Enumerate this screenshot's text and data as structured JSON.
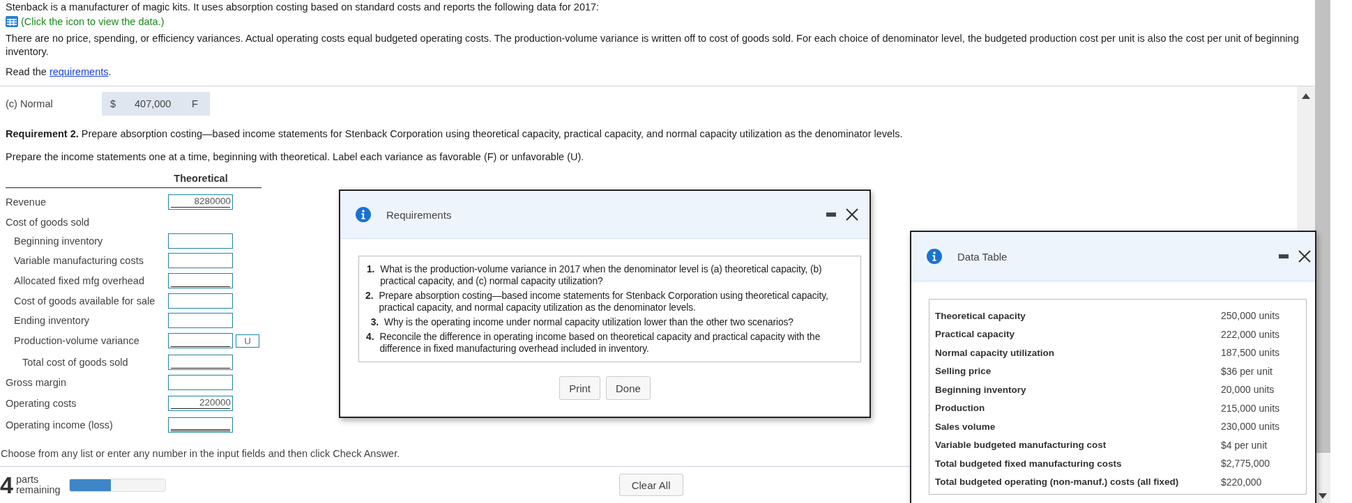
{
  "intro": {
    "text": "Stenback is a manufacturer of magic kits. It uses absorption costing based on standard costs and reports the following data for 2017:",
    "data_link": "(Click the icon to view the data.)",
    "note": "There are no price, spending, or efficiency variances. Actual operating costs equal budgeted operating costs. The production-volume variance is written off to cost of goods sold. For each choice of denominator level, the budgeted production cost per unit is also the cost per unit of beginning inventory.",
    "read_prefix": "Read the",
    "read_link": "requirements",
    "read_suffix": "."
  },
  "variance_summary": {
    "label": "(c) Normal",
    "currency": "$",
    "amount": "407,000",
    "flag": "F"
  },
  "requirement": "**Requirement 2.** Prepare absorption costing—based income statements for Stenback Corporation using theoretical capacity, practical capacity, and normal capacity utilization as the denominator levels.",
  "instruction": "Prepare the income statements one at a time, beginning with theoretical. Label each variance as favorable (F) or unfavorable (U).",
  "statement": {
    "column": "Theoretical",
    "rows": [
      {
        "label": "Revenue",
        "input": true,
        "value": "8280000",
        "underlined": true
      },
      {
        "label": "Cost of goods sold",
        "input": false,
        "children": [
          {
            "label": "Beginning inventory",
            "input": true,
            "underlined": false
          },
          {
            "label": "Variable manufacturing costs",
            "input": true,
            "underlined": false
          },
          {
            "label": "Allocated fixed mfg overhead",
            "input": true,
            "underlined": true
          },
          {
            "label": "Cost of goods available for sale",
            "input": true,
            "underlined": false
          },
          {
            "label": "Ending inventory",
            "input": true,
            "underlined": false
          },
          {
            "label": "Production-volume variance",
            "input": true,
            "underlined": true,
            "flag": "U"
          },
          {
            "label": "Total cost of goods sold",
            "input": true,
            "underlined": true,
            "kind": "total"
          }
        ]
      },
      {
        "label": "Gross margin",
        "input": true,
        "underlined": false
      },
      {
        "label": "Operating costs",
        "input": true,
        "value": "220000",
        "underlined": true
      },
      {
        "label": "Operating income (loss)",
        "input": true,
        "underlined": true,
        "double_underlined": true
      }
    ]
  },
  "footer": {
    "instruction": "Choose from any list or enter any number in the input fields and then click Check Answer.",
    "parts_count": "4",
    "parts_word": "parts",
    "remaining_word": "remaining",
    "level": 0.43,
    "button": "Clear All"
  },
  "requirements_dialog": {
    "title": "Requirements",
    "items": [
      {
        "number": "1.",
        "text": "What is the production-volume variance in 2017 when the denominator level is (a) theoretical capacity, (b) practical capacity, and (c) normal capacity utilization?"
      },
      {
        "number": "2.",
        "text": "Prepare absorption costing—based income statements for Stenback Corporation using theoretical capacity, practical capacity, and normal capacity utilization as the denominator levels."
      },
      {
        "number": "3.",
        "text": "Why is the operating income under normal capacity utilization lower than the other two scenarios?"
      },
      {
        "number": "4.",
        "text": "Reconcile the difference in operating income based on theoretical capacity and practical capacity with the difference in fixed manufacturing overhead included in inventory."
      }
    ],
    "buttons": [
      "Print",
      "Done"
    ]
  },
  "data_dialog": {
    "title": "Data Table",
    "rows": [
      {
        "label": "Theoretical capacity",
        "value": "250,000 units"
      },
      {
        "label": "Practical capacity",
        "value": "222,000 units"
      },
      {
        "label": "Normal capacity utilization",
        "value": "187,500 units"
      },
      {
        "label": "Selling price",
        "value": "$36 per unit"
      },
      {
        "label": "Beginning inventory",
        "value": "20,000 units"
      },
      {
        "label": "Production",
        "value": "215,000 units"
      },
      {
        "label": "Sales volume",
        "value": "230,000 units"
      },
      {
        "label": "Variable budgeted manufacturing cost",
        "value": "$4 per unit"
      },
      {
        "label": "Total budgeted fixed manufacturing costs",
        "value": "$2,775,000"
      },
      {
        "label": "Total budgeted operating (non-manuf.) costs (all fixed)",
        "value": "$220,000"
      }
    ]
  }
}
